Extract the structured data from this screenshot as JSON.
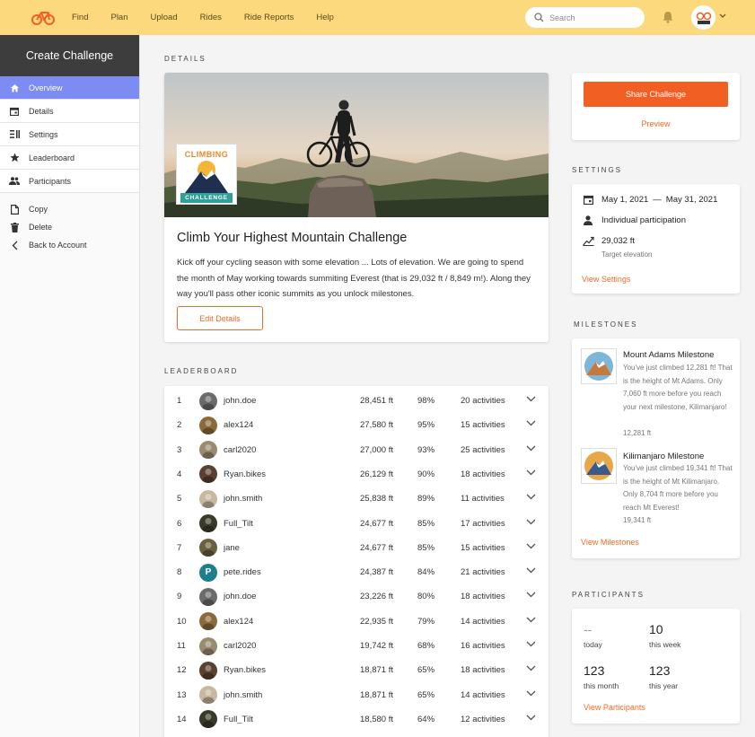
{
  "nav": {
    "items": [
      "Find",
      "Plan",
      "Upload",
      "Rides",
      "Ride Reports",
      "Help"
    ],
    "search_placeholder": "Search"
  },
  "sidebar": {
    "title": "Create Challenge",
    "items": [
      {
        "label": "Overview",
        "icon": "home-icon",
        "active": true
      },
      {
        "label": "Details",
        "icon": "calendar-icon"
      },
      {
        "label": "Settings",
        "icon": "list-icon"
      },
      {
        "label": "Leaderboard",
        "icon": "star-icon"
      },
      {
        "label": "Participants",
        "icon": "people-icon"
      }
    ],
    "links": [
      {
        "label": "Copy",
        "icon": "copy-icon"
      },
      {
        "label": "Delete",
        "icon": "trash-icon"
      },
      {
        "label": "Back to Account",
        "icon": "chevron-left-icon"
      }
    ]
  },
  "details": {
    "section_label": "DETAILS",
    "badge_top": "CLIMBING",
    "badge_bottom": "CHALLENGE",
    "title": "Climb Your Highest Mountain Challenge",
    "description": "Kick off your cycling season with some elevation ... Lots of elevation. We are going to spend the month of May working towards summiting Everest (that is 29,032 ft / 8,849 m!). Along they way you'll pass other iconic summits as you unlock milestones.",
    "edit_label": "Edit Details"
  },
  "leaderboard": {
    "section_label": "LEADERBOARD",
    "rows": [
      {
        "rank": "1",
        "user": "john.doe",
        "elevation": "28,451 ft",
        "pct": "98%",
        "activities": "20 activities",
        "avatar": "#6b6b6b"
      },
      {
        "rank": "2",
        "user": "alex124",
        "elevation": "27,580 ft",
        "pct": "95%",
        "activities": "15 activities",
        "avatar": "#8a6a3a"
      },
      {
        "rank": "3",
        "user": "carl2020",
        "elevation": "27,000 ft",
        "pct": "93%",
        "activities": "25 activities",
        "avatar": "#9a8a70"
      },
      {
        "rank": "4",
        "user": "Ryan.bikes",
        "elevation": "26,129 ft",
        "pct": "90%",
        "activities": "18 activities",
        "avatar": "#5a4030"
      },
      {
        "rank": "5",
        "user": "john.smith",
        "elevation": "25,838 ft",
        "pct": "89%",
        "activities": "11 activities",
        "avatar": "#c8b8a0"
      },
      {
        "rank": "6",
        "user": "Full_Tilt",
        "elevation": "24,677 ft",
        "pct": "85%",
        "activities": "17 activities",
        "avatar": "#3a3a2a"
      },
      {
        "rank": "7",
        "user": "jane",
        "elevation": "24,677 ft",
        "pct": "85%",
        "activities": "15 activities",
        "avatar": "#6a6040"
      },
      {
        "rank": "8",
        "user": "pete.rides",
        "elevation": "24,387 ft",
        "pct": "84%",
        "activities": "21 activities",
        "avatar": "#1e7f8c",
        "letter": "P"
      },
      {
        "rank": "9",
        "user": "john.doe",
        "elevation": "23,226 ft",
        "pct": "80%",
        "activities": "18 activities",
        "avatar": "#6b6b6b"
      },
      {
        "rank": "10",
        "user": "alex124",
        "elevation": "22,935 ft",
        "pct": "79%",
        "activities": "14 activities",
        "avatar": "#8a6a3a"
      },
      {
        "rank": "11",
        "user": "carl2020",
        "elevation": "19,742 ft",
        "pct": "68%",
        "activities": "16 activities",
        "avatar": "#9a8a70"
      },
      {
        "rank": "12",
        "user": "Ryan.bikes",
        "elevation": "18,871 ft",
        "pct": "65%",
        "activities": "18 activities",
        "avatar": "#5a4030"
      },
      {
        "rank": "13",
        "user": "john.smith",
        "elevation": "18,871 ft",
        "pct": "65%",
        "activities": "14 activities",
        "avatar": "#c8b8a0"
      },
      {
        "rank": "14",
        "user": "Full_Tilt",
        "elevation": "18,580 ft",
        "pct": "64%",
        "activities": "12 activities",
        "avatar": "#3a3a2a"
      }
    ]
  },
  "actions": {
    "share_label": "Share Challenge",
    "preview_label": "Preview"
  },
  "settings": {
    "section_label": "SETTINGS",
    "date_start": "May 1, 2021",
    "date_sep": "—",
    "date_end": "May 31, 2021",
    "participation": "Individual participation",
    "target_value": "29,032 ft",
    "target_label": "Target elevation",
    "link": "View Settings"
  },
  "milestones": {
    "section_label": "MILESTONES",
    "items": [
      {
        "title": "Mount Adams Milestone",
        "desc": "You've just climbed 12,281 ft! That is the height of Mt Adams. Only 7,060 ft more before you reach your next milestone, Kilimanjaro!",
        "value": "12,281 ft",
        "sky": "#7fb6d8"
      },
      {
        "title": "Kilimanjaro Milestone",
        "desc": "You've just climbed 19,341 ft! That is the height of Mt Kilimanjaro. Only 8,704 ft more before you reach Mt Everest!",
        "value": "19,341 ft",
        "sky": "#e8a84a"
      }
    ],
    "link": "View Milestones"
  },
  "participants": {
    "section_label": "PARTICIPANTS",
    "today_value": "--",
    "today_label": "today",
    "week_value": "10",
    "week_label": "this week",
    "month_value": "123",
    "month_label": "this month",
    "year_value": "123",
    "year_label": "this year",
    "link": "View Participants"
  },
  "colors": {
    "topbar": "#fbd97c",
    "accent": "#f15f22",
    "active": "#7d8cf2"
  }
}
